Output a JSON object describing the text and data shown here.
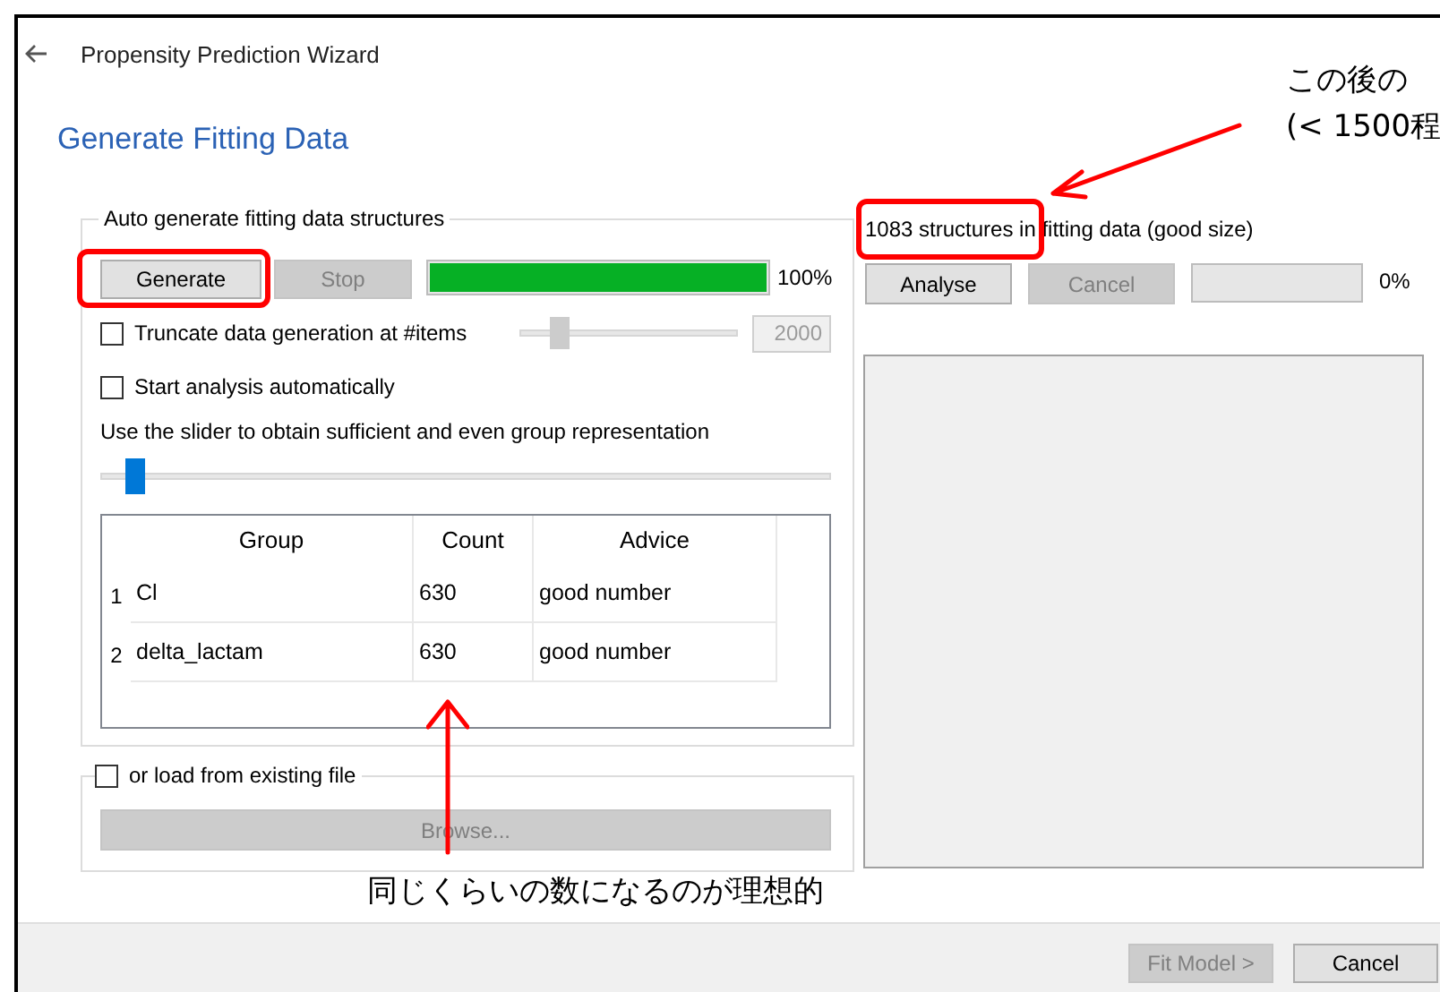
{
  "window": {
    "title": "Propensity Prediction Wizard"
  },
  "page_title": "Generate Fitting Data",
  "auto_generate": {
    "label": "Auto generate fitting data structures",
    "generate_button": {
      "label": "Generate",
      "disabled": false
    },
    "stop_button": {
      "label": "Stop",
      "disabled": true
    },
    "progress": {
      "level": 1
    },
    "progress_reading": "100%",
    "truncate": {
      "label": "Truncate data generation at #items",
      "checked": false
    },
    "truncate_slider": {
      "level": 0.15,
      "disabled": true
    },
    "truncate_field": {
      "value": "2000",
      "disabled": true
    },
    "auto_analysis": {
      "label": "Start analysis automatically",
      "checked": false
    },
    "hint": "Use the slider to obtain sufficient and even group representation",
    "group_slider": {
      "level": 0.035
    },
    "table": {
      "columns": [
        "Group",
        "Count",
        "Advice"
      ],
      "rows": [
        {
          "index": "1",
          "cells": [
            "Cl",
            "630",
            "good number"
          ]
        },
        {
          "index": "2",
          "cells": [
            "delta_lactam",
            "630",
            "good number"
          ]
        }
      ]
    }
  },
  "load_file": {
    "label": "or load from existing file",
    "checked": false,
    "browse_button": {
      "label": "Browse...",
      "disabled": true
    }
  },
  "analysis": {
    "summary": "1083 structures in fitting data (good size)",
    "analyse_button": {
      "label": "Analyse",
      "disabled": false
    },
    "cancel_button": {
      "label": "Cancel",
      "disabled": true
    },
    "progress": {
      "level": 0
    },
    "progress_reading": "0%"
  },
  "footer": {
    "buttons": [
      {
        "label": "Fit Model >",
        "disabled": true
      },
      {
        "label": "Cancel",
        "disabled": false
      }
    ]
  },
  "annotations": {
    "count_note": {
      "lines": [
        "この後の",
        "(< 1500程"
      ]
    },
    "table_note": {
      "text": "同じくらいの数になるのが理想的"
    }
  }
}
